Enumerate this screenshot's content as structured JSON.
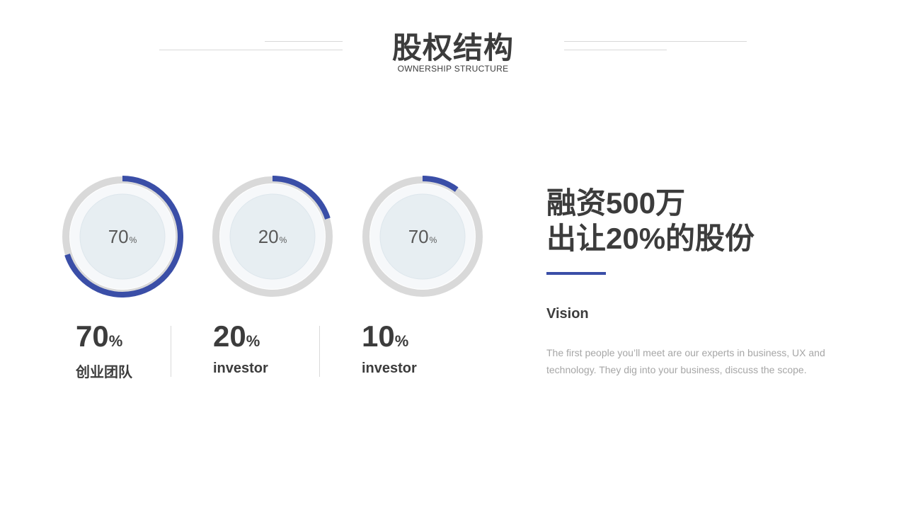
{
  "header": {
    "title": "股权结构",
    "subtitle": "OWNERSHIP STRUCTURE"
  },
  "colors": {
    "accent": "#3a4ea7",
    "track": "#d9d9d9",
    "inner_fill": "#e7eef2",
    "text_dark": "#3c3c3c",
    "text_muted": "#a6a6a6"
  },
  "chart_data": {
    "type": "donut",
    "series": [
      {
        "ring_label": "70",
        "ring_unit": "%",
        "fraction": 0.7
      },
      {
        "ring_label": "20",
        "ring_unit": "%",
        "fraction": 0.2
      },
      {
        "ring_label": "70",
        "ring_unit": "%",
        "fraction": 0.1
      }
    ]
  },
  "stats": [
    {
      "value": "70",
      "unit": "%",
      "label": "创业团队"
    },
    {
      "value": "20",
      "unit": "%",
      "label": "investor"
    },
    {
      "value": "10",
      "unit": "%",
      "label": "investor"
    }
  ],
  "headline": {
    "line1": "融资500万",
    "line2": "出让20%的股份"
  },
  "vision": {
    "title": "Vision",
    "body": "The first people you’ll meet are our experts in business, UX and technology. They dig into your business, discuss the scope."
  }
}
